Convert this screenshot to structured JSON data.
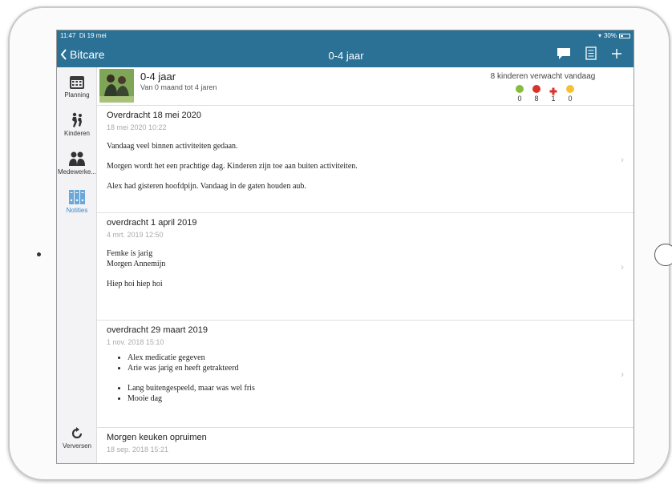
{
  "status": {
    "time": "11:47",
    "date": "Di 19 mei",
    "battery": "30%"
  },
  "nav": {
    "back_label": "Bitcare",
    "title": "0-4 jaar"
  },
  "sidebar": {
    "items": [
      {
        "label": "Planning"
      },
      {
        "label": "Kinderen"
      },
      {
        "label": "Medewerke..."
      },
      {
        "label": "Notities"
      }
    ],
    "refresh_label": "Verversen"
  },
  "group": {
    "title": "0-4 jaar",
    "subtitle": "Van 0 maand tot 4 jaren",
    "expected": "8 kinderen verwacht vandaag",
    "counts": [
      "0",
      "8",
      "1",
      "0"
    ],
    "colors": [
      "#86bd3e",
      "#d8342c",
      "#d8342c",
      "#f4c234"
    ]
  },
  "notes": [
    {
      "title": "Overdracht 18 mei 2020",
      "date": "18 mei 2020 10:22",
      "lines": [
        "Vandaag veel binnen activiteiten gedaan.",
        "Morgen wordt het een prachtige dag. Kinderen zijn toe aan buiten activiteiten.",
        "Alex had gisteren hoofdpijn. Vandaag in de gaten houden aub."
      ]
    },
    {
      "title": "overdracht 1 april 2019",
      "date": "4 mrt. 2019 12:50",
      "lines": [
        "Femke is jarig",
        "Morgen Annemijn",
        "Hiep hoi hiep hoi"
      ]
    },
    {
      "title": "overdracht 29 maart 2019",
      "date": "1 nov. 2018 15:10",
      "bullets": [
        "Alex medicatie gegeven",
        "Arie was jarig en heeft getrakteerd",
        "Lang buitengespeeld, maar was wel fris",
        "Mooie dag"
      ]
    },
    {
      "title": "Morgen keuken opruimen",
      "date": "18 sep. 2018 15:21"
    }
  ]
}
